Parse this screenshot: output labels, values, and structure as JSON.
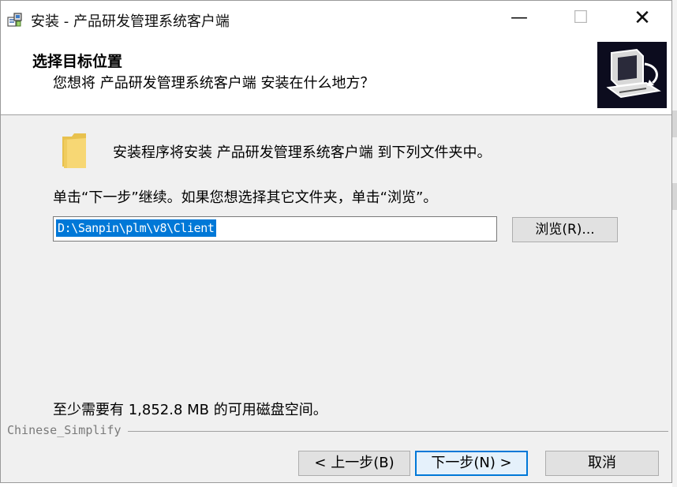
{
  "window": {
    "title": "安装 - 产品研发管理系统客户端",
    "minimize_glyph": "—",
    "maximize_glyph": "☐",
    "close_glyph": "✕"
  },
  "header": {
    "title": "选择目标位置",
    "subtitle": "您想将 产品研发管理系统客户端 安装在什么地方？"
  },
  "main": {
    "intro": "安装程序将安装 产品研发管理系统客户端 到下列文件夹中。",
    "instruction": "单击“下一步”继续。如果您想选择其它文件夹，单击“浏览”。",
    "path_value": "D:\\Sanpin\\plm\\v8\\Client",
    "browse_label": "浏览(R)...",
    "disk_space": "至少需要有 1,852.8 MB 的可用磁盘空间。"
  },
  "footer": {
    "language_label": "Chinese_Simplify",
    "back_label": "< 上一步(B)",
    "next_label": "下一步(N) >",
    "cancel_label": "取消"
  },
  "icons": {
    "app": "installer-icon",
    "folder": "folder-icon",
    "logo": "computer-install-logo"
  },
  "colors": {
    "selection": "#0078d7",
    "window_bg": "#f0f0f0",
    "header_bg": "#ffffff",
    "folder": "#f7d774"
  }
}
